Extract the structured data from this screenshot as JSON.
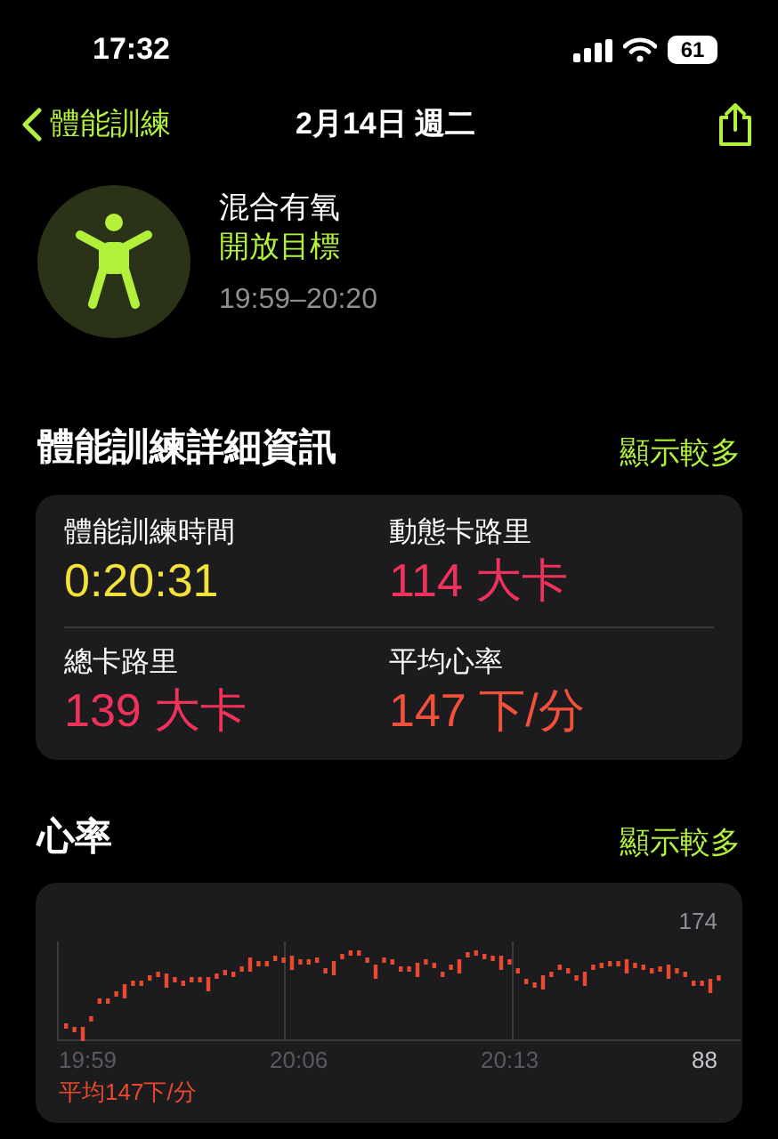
{
  "status_bar": {
    "time": "17:32",
    "battery": "61"
  },
  "nav": {
    "back": "體能訓練",
    "title": "2月14日 週二"
  },
  "workout": {
    "name": "混合有氧",
    "goal": "開放目標",
    "time_range": "19:59–20:20"
  },
  "details": {
    "title": "體能訓練詳細資訊",
    "more": "顯示較多",
    "metrics": [
      {
        "label": "體能訓練時間",
        "value": "0:20:31",
        "color": "#f2e23a"
      },
      {
        "label": "動態卡路里",
        "value": "114 大卡",
        "color": "#f0325a"
      },
      {
        "label": "總卡路里",
        "value": "139 大卡",
        "color": "#f0325a"
      },
      {
        "label": "平均心率",
        "value": "147 下/分",
        "color": "#f1503a"
      }
    ]
  },
  "heart_rate": {
    "title": "心率",
    "more": "顯示較多",
    "max": "174",
    "min": "88",
    "times": [
      "19:59",
      "20:06",
      "20:13"
    ],
    "average": "平均147下/分"
  }
}
